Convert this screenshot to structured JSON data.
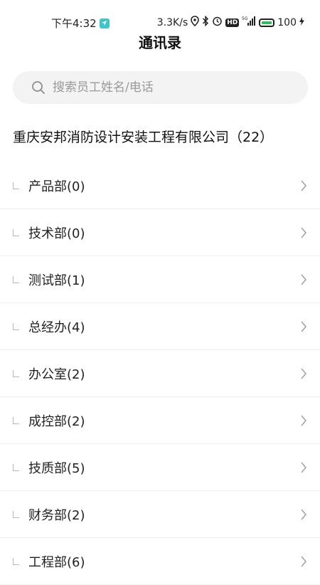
{
  "status_bar": {
    "time": "下午4:32",
    "network_speed": "3.3K/s",
    "signal_label": "5G",
    "hd_label": "HD",
    "battery": "100"
  },
  "header": {
    "title": "通讯录"
  },
  "search": {
    "placeholder": "搜索员工姓名/电话",
    "value": ""
  },
  "company": {
    "name": "重庆安邦消防设计安装工程有限公司（22）"
  },
  "departments": [
    {
      "label": "产品部(0)"
    },
    {
      "label": "技术部(0)"
    },
    {
      "label": "测试部(1)"
    },
    {
      "label": "总经办(4)"
    },
    {
      "label": "办公室(2)"
    },
    {
      "label": "成控部(2)"
    },
    {
      "label": "技质部(5)"
    },
    {
      "label": "财务部(2)"
    },
    {
      "label": "工程部(6)"
    }
  ],
  "colors": {
    "accent": "#3cc6c9",
    "battery": "#2dbf5f",
    "search_bg": "#f3f3f3"
  }
}
